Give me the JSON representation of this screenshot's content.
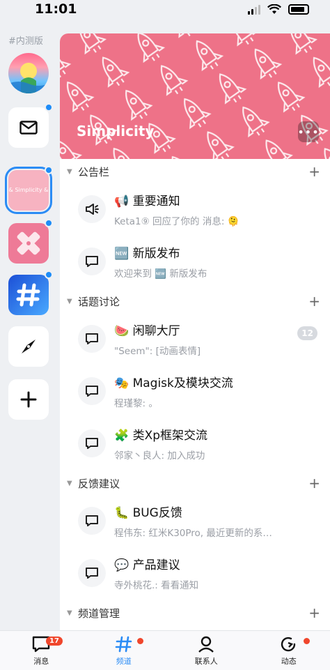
{
  "status": {
    "time": "11:01"
  },
  "rail": {
    "beta_label": "#内测版",
    "selected_server_label": "& Simplicity &"
  },
  "server": {
    "name": "Simplicity",
    "more_label": "•••"
  },
  "sections": [
    {
      "title": "公告栏",
      "channels": [
        {
          "icon": "megaphone-icon",
          "emoji": "📢",
          "name": "重要通知",
          "sub": "Keta1⑨ 回应了你的 消息: 🫠"
        },
        {
          "icon": "chat-bubble-icon",
          "emoji": "🆕",
          "name": "新版发布",
          "sub": "欢迎来到 🆕 新版发布"
        }
      ]
    },
    {
      "title": "话题讨论",
      "channels": [
        {
          "icon": "chat-bubble-icon",
          "emoji": "🍉",
          "name": "闲聊大厅",
          "sub": "\"Seem\": [动画表情]",
          "badge": "12"
        },
        {
          "icon": "chat-bubble-icon",
          "emoji": "🎭",
          "name": "Magisk及模块交流",
          "sub": "程瑾黎: 。"
        },
        {
          "icon": "chat-bubble-icon",
          "emoji": "🧩",
          "name": "类Xp框架交流",
          "sub": "邻家丶良人: 加入成功"
        }
      ]
    },
    {
      "title": "反馈建议",
      "channels": [
        {
          "icon": "chat-bubble-icon",
          "emoji": "🐛",
          "name": "BUG反馈",
          "sub": "程伟东: 红米K30Pro, 最近更新的系…"
        },
        {
          "icon": "chat-bubble-icon",
          "emoji": "💬",
          "name": "产品建议",
          "sub": "寺外桃花.: 看看通知"
        }
      ]
    },
    {
      "title": "频道管理",
      "channels": []
    }
  ],
  "tabs": {
    "messages": {
      "label": "消息",
      "badge": "17"
    },
    "channels": {
      "label": "频道"
    },
    "contacts": {
      "label": "联系人"
    },
    "activity": {
      "label": "动态"
    }
  },
  "colors": {
    "accent": "#2b8cf5",
    "badge_red": "#f0462c",
    "banner_pink": "#ee7288"
  }
}
